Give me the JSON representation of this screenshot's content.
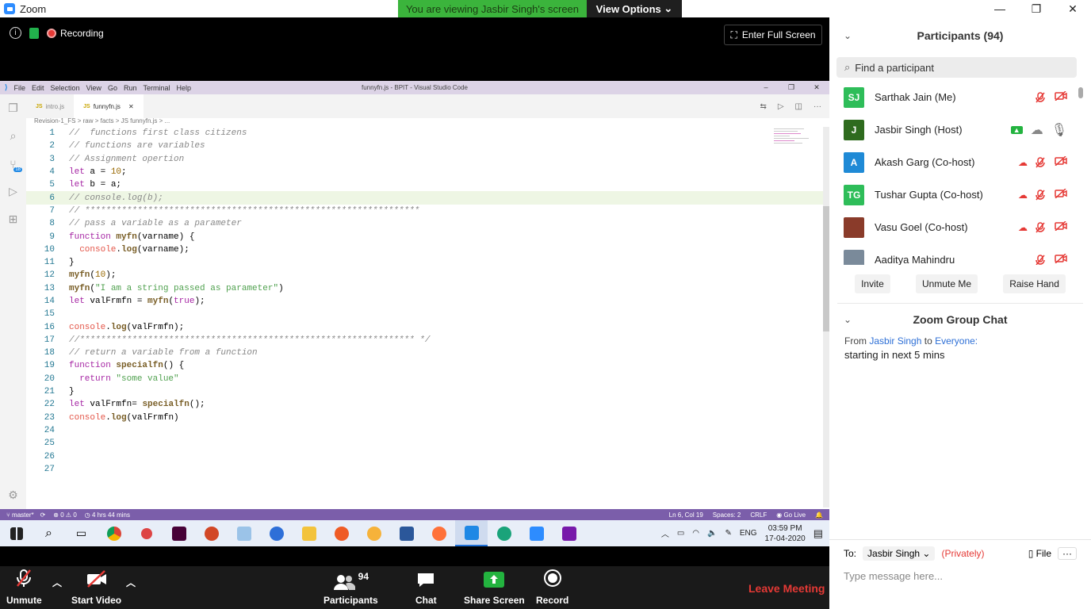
{
  "app": {
    "title": "Zoom"
  },
  "banner": {
    "message": "You are viewing Jasbir Singh's screen",
    "view_options": "View Options"
  },
  "meeting": {
    "recording": "Recording",
    "fullscreen": "Enter Full Screen"
  },
  "vscode": {
    "menu": [
      "File",
      "Edit",
      "Selection",
      "View",
      "Go",
      "Run",
      "Terminal",
      "Help"
    ],
    "window_title": "funnyfn.js - BPIT - Visual Studio Code",
    "tabs": [
      {
        "label": "intro.js",
        "active": false
      },
      {
        "label": "funnyfn.js",
        "active": true
      }
    ],
    "breadcrumb": "Revision-1_FS  >  raw  >  facts  >  JS funnyfn.js  >  ...",
    "badge": "18",
    "status_left": {
      "branch": "master*",
      "errors": "0",
      "warnings": "0",
      "timer": "4 hrs 44 mins"
    },
    "status_right": {
      "position": "Ln 6, Col 19",
      "spaces": "Spaces: 2",
      "eol": "CRLF",
      "golive": "Go Live"
    },
    "highlight_line": 6
  },
  "code_lines": [
    "//  functions first class citizens",
    "// functions are variables",
    "// Assignment opertion",
    "let a = 10;",
    "let b = a;",
    "// console.log(b);",
    "// ****************************************************************",
    "// pass a variable as a parameter",
    "function myfn(varname) {",
    "  console.log(varname);",
    "}",
    "myfn(10);",
    "myfn(\"I am a string passed as parameter\")",
    "let valFrmfn = myfn(true);",
    "",
    "console.log(valFrmfn);",
    "//**************************************************************** */",
    "// return a variable from a function",
    "function specialfn() {",
    "  return \"some value\"",
    "}",
    "let valFrmfn= specialfn();",
    "console.log(valFrmfn)",
    "",
    "",
    "",
    ""
  ],
  "taskbar": {
    "lang": "ENG",
    "time": "03:59 PM",
    "date": "17-04-2020"
  },
  "toolbar": {
    "unmute": "Unmute",
    "start_video": "Start Video",
    "participants": "Participants",
    "participants_count": "94",
    "chat": "Chat",
    "share": "Share Screen",
    "record": "Record",
    "leave": "Leave Meeting"
  },
  "participants_panel": {
    "title": "Participants (94)",
    "search_placeholder": "Find a participant",
    "list": [
      {
        "initials": "SJ",
        "name": "Sarthak Jain (Me)",
        "color": "#2ebd59"
      },
      {
        "initials": "J",
        "name": "Jasbir Singh (Host)",
        "color": "#2e6b1e"
      },
      {
        "initials": "A",
        "name": "Akash Garg (Co-host)",
        "color": "#1f8ad6"
      },
      {
        "initials": "TG",
        "name": "Tushar Gupta (Co-host)",
        "color": "#2ebd59"
      },
      {
        "initials": "",
        "name": "Vasu Goel (Co-host)",
        "color": "#8a3b2a"
      },
      {
        "initials": "",
        "name": "Aaditya Mahindru",
        "color": "#7a8a9a"
      }
    ],
    "buttons": [
      "Invite",
      "Unmute Me",
      "Raise Hand"
    ]
  },
  "chat_panel": {
    "title": "Zoom Group Chat",
    "from_label": "From",
    "sender": "Jasbir Singh",
    "to_label": "to",
    "recipient": "Everyone:",
    "message": "starting in next 5 mins",
    "to_prefix": "To:",
    "to_value": "Jasbir Singh",
    "privately": "(Privately)",
    "file": "File",
    "input_placeholder": "Type message here..."
  }
}
